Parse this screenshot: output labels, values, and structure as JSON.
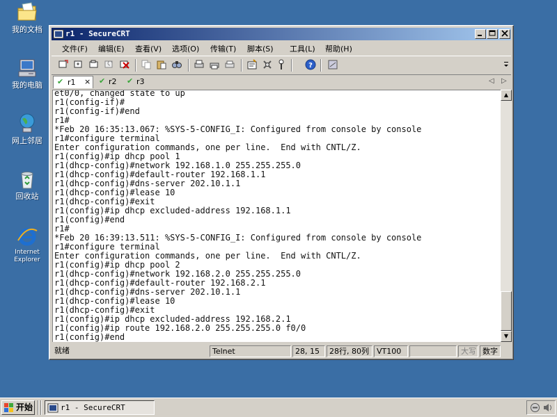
{
  "desktop": {
    "icons": [
      {
        "label": "我的文档",
        "icon": "folder-documents-icon"
      },
      {
        "label": "我的电脑",
        "icon": "computer-icon"
      },
      {
        "label": "网上邻居",
        "icon": "network-icon"
      },
      {
        "label": "回收站",
        "icon": "recycle-bin-icon"
      },
      {
        "label": "Internet Explorer",
        "icon": "ie-icon"
      }
    ]
  },
  "window": {
    "title": "r1 - SecureCRT",
    "menu": [
      "文件(F)",
      "编辑(E)",
      "查看(V)",
      "选项(O)",
      "传输(T)",
      "脚本(S)",
      "工具(L)",
      "帮助(H)"
    ],
    "tabs": [
      {
        "label": "r1",
        "active": true
      },
      {
        "label": "r2",
        "active": false
      },
      {
        "label": "r3",
        "active": false
      }
    ],
    "tab_close": "×",
    "terminal_lines": [
      "et0/0, changed state to up",
      "r1(config-if)#",
      "r1(config-if)#end",
      "r1#",
      "*Feb 20 16:35:13.067: %SYS-5-CONFIG_I: Configured from console by console",
      "r1#configure terminal",
      "Enter configuration commands, one per line.  End with CNTL/Z.",
      "r1(config)#ip dhcp pool 1",
      "r1(dhcp-config)#network 192.168.1.0 255.255.255.0",
      "r1(dhcp-config)#default-router 192.168.1.1",
      "r1(dhcp-config)#dns-server 202.10.1.1",
      "r1(dhcp-config)#lease 10",
      "r1(dhcp-config)#exit",
      "r1(config)#ip dhcp excluded-address 192.168.1.1",
      "r1(config)#end",
      "r1#",
      "*Feb 20 16:39:13.511: %SYS-5-CONFIG_I: Configured from console by console",
      "r1#configure terminal",
      "Enter configuration commands, one per line.  End with CNTL/Z.",
      "r1(config)#ip dhcp pool 2",
      "r1(dhcp-config)#network 192.168.2.0 255.255.255.0",
      "r1(dhcp-config)#default-router 192.168.2.1",
      "r1(dhcp-config)#dns-server 202.10.1.1",
      "r1(dhcp-config)#lease 10",
      "r1(dhcp-config)#exit",
      "r1(config)#ip dhcp excluded-address 192.168.2.1",
      "r1(config)#ip route 192.168.2.0 255.255.255.0 f0/0",
      "r1(config)#end"
    ],
    "status": {
      "ready": "就绪",
      "protocol": "Telnet",
      "cursor": "28, 15",
      "size": "28行, 80列",
      "emulation": "VT100",
      "caps": "大写",
      "num": "数字"
    }
  },
  "taskbar": {
    "start_label": "开始",
    "task_label": "r1 - SecureCRT"
  }
}
